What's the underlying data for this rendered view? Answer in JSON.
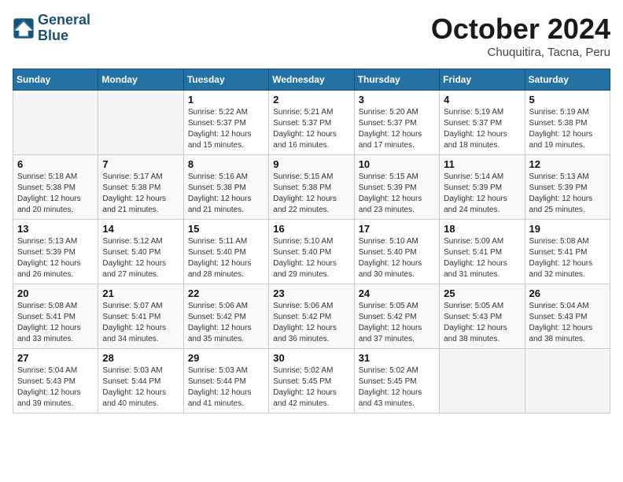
{
  "header": {
    "logo_line1": "General",
    "logo_line2": "Blue",
    "month": "October 2024",
    "location": "Chuquitira, Tacna, Peru"
  },
  "weekdays": [
    "Sunday",
    "Monday",
    "Tuesday",
    "Wednesday",
    "Thursday",
    "Friday",
    "Saturday"
  ],
  "weeks": [
    [
      {
        "day": "",
        "info": ""
      },
      {
        "day": "",
        "info": ""
      },
      {
        "day": "1",
        "info": "Sunrise: 5:22 AM\nSunset: 5:37 PM\nDaylight: 12 hours and 15 minutes."
      },
      {
        "day": "2",
        "info": "Sunrise: 5:21 AM\nSunset: 5:37 PM\nDaylight: 12 hours and 16 minutes."
      },
      {
        "day": "3",
        "info": "Sunrise: 5:20 AM\nSunset: 5:37 PM\nDaylight: 12 hours and 17 minutes."
      },
      {
        "day": "4",
        "info": "Sunrise: 5:19 AM\nSunset: 5:37 PM\nDaylight: 12 hours and 18 minutes."
      },
      {
        "day": "5",
        "info": "Sunrise: 5:19 AM\nSunset: 5:38 PM\nDaylight: 12 hours and 19 minutes."
      }
    ],
    [
      {
        "day": "6",
        "info": "Sunrise: 5:18 AM\nSunset: 5:38 PM\nDaylight: 12 hours and 20 minutes."
      },
      {
        "day": "7",
        "info": "Sunrise: 5:17 AM\nSunset: 5:38 PM\nDaylight: 12 hours and 21 minutes."
      },
      {
        "day": "8",
        "info": "Sunrise: 5:16 AM\nSunset: 5:38 PM\nDaylight: 12 hours and 21 minutes."
      },
      {
        "day": "9",
        "info": "Sunrise: 5:15 AM\nSunset: 5:38 PM\nDaylight: 12 hours and 22 minutes."
      },
      {
        "day": "10",
        "info": "Sunrise: 5:15 AM\nSunset: 5:39 PM\nDaylight: 12 hours and 23 minutes."
      },
      {
        "day": "11",
        "info": "Sunrise: 5:14 AM\nSunset: 5:39 PM\nDaylight: 12 hours and 24 minutes."
      },
      {
        "day": "12",
        "info": "Sunrise: 5:13 AM\nSunset: 5:39 PM\nDaylight: 12 hours and 25 minutes."
      }
    ],
    [
      {
        "day": "13",
        "info": "Sunrise: 5:13 AM\nSunset: 5:39 PM\nDaylight: 12 hours and 26 minutes."
      },
      {
        "day": "14",
        "info": "Sunrise: 5:12 AM\nSunset: 5:40 PM\nDaylight: 12 hours and 27 minutes."
      },
      {
        "day": "15",
        "info": "Sunrise: 5:11 AM\nSunset: 5:40 PM\nDaylight: 12 hours and 28 minutes."
      },
      {
        "day": "16",
        "info": "Sunrise: 5:10 AM\nSunset: 5:40 PM\nDaylight: 12 hours and 29 minutes."
      },
      {
        "day": "17",
        "info": "Sunrise: 5:10 AM\nSunset: 5:40 PM\nDaylight: 12 hours and 30 minutes."
      },
      {
        "day": "18",
        "info": "Sunrise: 5:09 AM\nSunset: 5:41 PM\nDaylight: 12 hours and 31 minutes."
      },
      {
        "day": "19",
        "info": "Sunrise: 5:08 AM\nSunset: 5:41 PM\nDaylight: 12 hours and 32 minutes."
      }
    ],
    [
      {
        "day": "20",
        "info": "Sunrise: 5:08 AM\nSunset: 5:41 PM\nDaylight: 12 hours and 33 minutes."
      },
      {
        "day": "21",
        "info": "Sunrise: 5:07 AM\nSunset: 5:41 PM\nDaylight: 12 hours and 34 minutes."
      },
      {
        "day": "22",
        "info": "Sunrise: 5:06 AM\nSunset: 5:42 PM\nDaylight: 12 hours and 35 minutes."
      },
      {
        "day": "23",
        "info": "Sunrise: 5:06 AM\nSunset: 5:42 PM\nDaylight: 12 hours and 36 minutes."
      },
      {
        "day": "24",
        "info": "Sunrise: 5:05 AM\nSunset: 5:42 PM\nDaylight: 12 hours and 37 minutes."
      },
      {
        "day": "25",
        "info": "Sunrise: 5:05 AM\nSunset: 5:43 PM\nDaylight: 12 hours and 38 minutes."
      },
      {
        "day": "26",
        "info": "Sunrise: 5:04 AM\nSunset: 5:43 PM\nDaylight: 12 hours and 38 minutes."
      }
    ],
    [
      {
        "day": "27",
        "info": "Sunrise: 5:04 AM\nSunset: 5:43 PM\nDaylight: 12 hours and 39 minutes."
      },
      {
        "day": "28",
        "info": "Sunrise: 5:03 AM\nSunset: 5:44 PM\nDaylight: 12 hours and 40 minutes."
      },
      {
        "day": "29",
        "info": "Sunrise: 5:03 AM\nSunset: 5:44 PM\nDaylight: 12 hours and 41 minutes."
      },
      {
        "day": "30",
        "info": "Sunrise: 5:02 AM\nSunset: 5:45 PM\nDaylight: 12 hours and 42 minutes."
      },
      {
        "day": "31",
        "info": "Sunrise: 5:02 AM\nSunset: 5:45 PM\nDaylight: 12 hours and 43 minutes."
      },
      {
        "day": "",
        "info": ""
      },
      {
        "day": "",
        "info": ""
      }
    ]
  ]
}
